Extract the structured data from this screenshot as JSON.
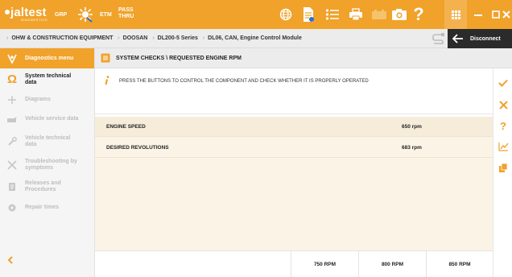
{
  "app": {
    "logo": "jaltest",
    "logo_sub": "DIAGNOSTICS",
    "grp": "GRP",
    "etm": "ETM",
    "pass_thru_line1": "PASS",
    "pass_thru_line2": "THRU"
  },
  "breadcrumb": {
    "items": [
      "OHW & CONSTRUCTION EQUIPMENT",
      "DOOSAN",
      "DL200-5 Series",
      "DL06, CAN, Engine Control Module"
    ]
  },
  "disconnect_label": "Disconnect",
  "sidebar": {
    "header": "Diagnostics menu",
    "items": [
      {
        "label": "System technical data",
        "icon": "omega-icon",
        "active": true
      },
      {
        "label": "Diagrams",
        "icon": "diagram-icon",
        "active": false
      },
      {
        "label": "Vehicle service data",
        "icon": "oil-can-icon",
        "active": false
      },
      {
        "label": "Vehicle technical data",
        "icon": "wrench-icon",
        "active": false
      },
      {
        "label": "Troubleshooting by symptoms",
        "icon": "tools-icon",
        "active": false
      },
      {
        "label": "Releases and Procedures",
        "icon": "document-icon",
        "active": false
      },
      {
        "label": "Repair times",
        "icon": "gear-icon",
        "active": false
      }
    ]
  },
  "main": {
    "title": "SYSTEM CHECKS \\ REQUESTED ENGINE RPM",
    "info": "PRESS THE BUTTONS TO CONTROL THE COMPONENT AND CHECK WHETHER IT IS PROPERLY OPERATED",
    "rows": [
      {
        "name": "ENGINE SPEED",
        "value": "650 rpm"
      },
      {
        "name": "DESIRED REVOLUTIONS",
        "value": "683 rpm"
      }
    ],
    "buttons": [
      "750 RPM",
      "800 RPM",
      "850 RPM"
    ]
  },
  "colors": {
    "accent": "#f0a22a",
    "dark": "#2b2b2b",
    "row_bg": "#fbf4e6"
  }
}
